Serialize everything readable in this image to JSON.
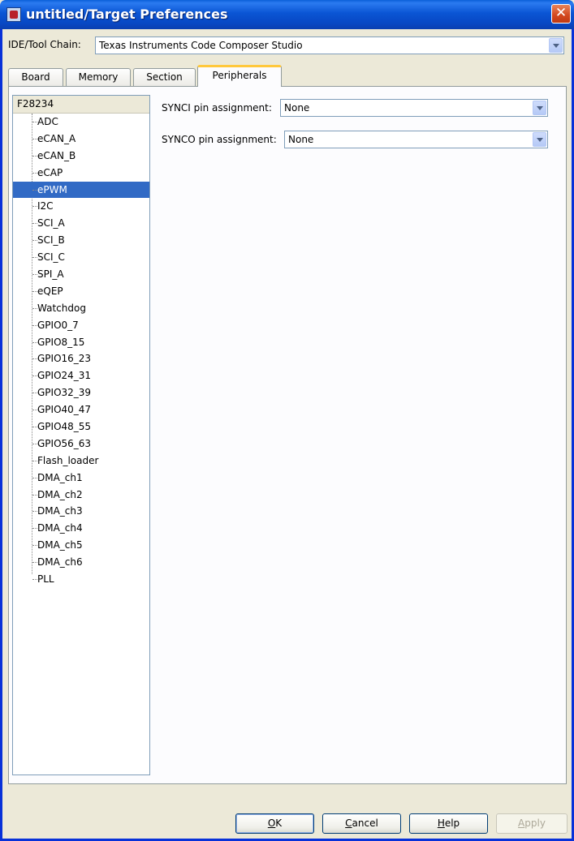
{
  "window": {
    "title": "untitled/Target Preferences",
    "close_glyph": "✕"
  },
  "ide": {
    "label": "IDE/Tool Chain:",
    "value": "Texas Instruments Code Composer Studio"
  },
  "tabs": [
    {
      "label": "Board",
      "active": false
    },
    {
      "label": "Memory",
      "active": false
    },
    {
      "label": "Section",
      "active": false
    },
    {
      "label": "Peripherals",
      "active": true
    }
  ],
  "tree": {
    "root": "F28234",
    "selected": "ePWM",
    "items": [
      "ADC",
      "eCAN_A",
      "eCAN_B",
      "eCAP",
      "ePWM",
      "I2C",
      "SCI_A",
      "SCI_B",
      "SCI_C",
      "SPI_A",
      "eQEP",
      "Watchdog",
      "GPIO0_7",
      "GPIO8_15",
      "GPIO16_23",
      "GPIO24_31",
      "GPIO32_39",
      "GPIO40_47",
      "GPIO48_55",
      "GPIO56_63",
      "Flash_loader",
      "DMA_ch1",
      "DMA_ch2",
      "DMA_ch3",
      "DMA_ch4",
      "DMA_ch5",
      "DMA_ch6",
      "PLL"
    ]
  },
  "fields": {
    "synci": {
      "label": "SYNCI pin assignment:",
      "value": "None"
    },
    "synco": {
      "label": "SYNCO pin assignment:",
      "value": "None"
    }
  },
  "buttons": {
    "ok": {
      "label": "OK",
      "mnemonic": "O",
      "rest": "K"
    },
    "cancel": {
      "label": "Cancel",
      "mnemonic": "C",
      "rest": "ancel"
    },
    "help": {
      "label": "Help",
      "mnemonic": "H",
      "rest": "elp"
    },
    "apply": {
      "label": "Apply",
      "mnemonic": "A",
      "rest": "pply"
    }
  },
  "colors": {
    "selection": "#316ac5",
    "title_bar": "#0a55d4",
    "active_tab_accent": "#ffc83c"
  }
}
